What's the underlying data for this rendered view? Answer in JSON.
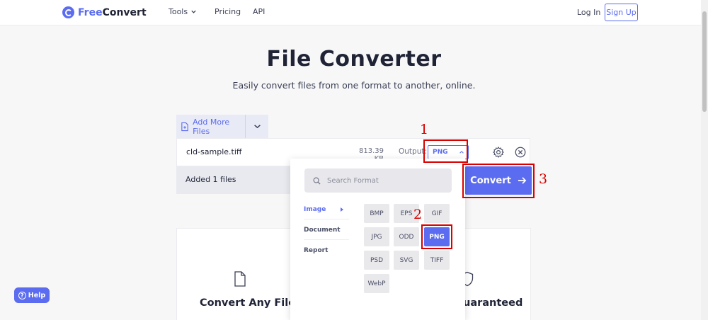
{
  "header": {
    "logo_free": "Free",
    "logo_convert": "Convert",
    "nav": {
      "tools": "Tools",
      "pricing": "Pricing",
      "api": "API"
    },
    "login": "Log In",
    "signup": "Sign Up"
  },
  "hero": {
    "title": "File Converter",
    "subtitle": "Easily convert files from one format to another, online."
  },
  "uploader": {
    "add_more_label": "Add More Files",
    "file": {
      "name": "cld-sample.tiff",
      "size": "813.39 KB",
      "output_label": "Output:",
      "output_format": "PNG"
    },
    "added_text": "Added 1 files",
    "convert_label": "Convert"
  },
  "format_menu": {
    "search_placeholder": "Search Format",
    "categories": [
      {
        "label": "Image",
        "active": true
      },
      {
        "label": "Document",
        "active": false
      },
      {
        "label": "Report",
        "active": false
      }
    ],
    "formats": [
      {
        "label": "BMP",
        "selected": false
      },
      {
        "label": "EPS",
        "selected": false
      },
      {
        "label": "GIF",
        "selected": false
      },
      {
        "label": "JPG",
        "selected": false
      },
      {
        "label": "ODD",
        "selected": false
      },
      {
        "label": "PNG",
        "selected": true
      },
      {
        "label": "PSD",
        "selected": false
      },
      {
        "label": "SVG",
        "selected": false
      },
      {
        "label": "TIFF",
        "selected": false
      },
      {
        "label": "WebP",
        "selected": false
      }
    ]
  },
  "features": {
    "left_title": "Convert Any File",
    "right_title": "uaranteed"
  },
  "annotations": {
    "step1": "1",
    "step2": "2",
    "step3": "3"
  },
  "help": {
    "label": "Help",
    "glyph": "?"
  },
  "colors": {
    "accent": "#5b6cf0",
    "annotation_red": "#d90000"
  },
  "icons": [
    "logo-icon",
    "chevron-down-icon",
    "file-plus-icon",
    "chevron-up-icon",
    "gear-icon",
    "close-circle-icon",
    "arrow-right-icon",
    "search-icon",
    "caret-right-icon",
    "file-icon",
    "shield-icon",
    "help-icon"
  ]
}
